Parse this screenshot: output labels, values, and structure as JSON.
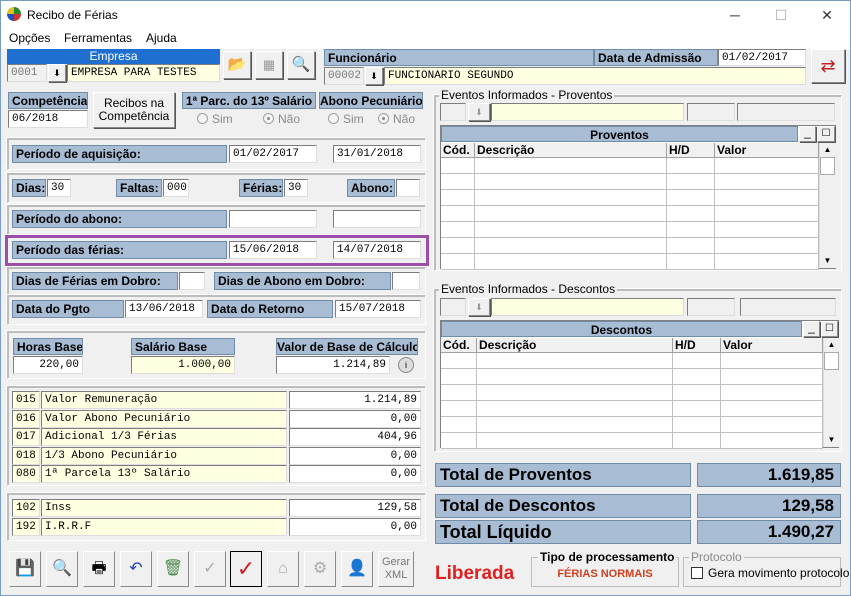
{
  "window": {
    "title": "Recibo de Férias",
    "min": "─",
    "max": "☐",
    "close": "✕"
  },
  "menu": [
    "Opções",
    "Ferramentas",
    "Ajuda"
  ],
  "empresa": {
    "label": "Empresa",
    "code": "0001",
    "name": "EMPRESA PARA TESTES"
  },
  "funcionario": {
    "label": "Funcionário",
    "code": "00002",
    "name": "FUNCIONARIO SEGUNDO",
    "adm_label": "Data de Admissão",
    "adm": "01/02/2017"
  },
  "competencia": {
    "label": "Competência",
    "value": "06/2018",
    "recibos_btn": "Recibos na Competência"
  },
  "parc13": {
    "label": "1ª Parc. do 13º Salário",
    "sim": "Sim",
    "nao": "Não"
  },
  "abono": {
    "label": "Abono Pecuniário",
    "sim": "Sim",
    "nao": "Não"
  },
  "aquisicao": {
    "label": "Período de aquisição:",
    "start": "01/02/2017",
    "end": "31/01/2018"
  },
  "dias": {
    "dias_label": "Dias:",
    "dias": "30",
    "faltas_label": "Faltas:",
    "faltas": "000",
    "ferias_label": "Férias:",
    "ferias": "30",
    "abono_label": "Abono:",
    "abono": ""
  },
  "periodo_abono": {
    "label": "Período do abono:"
  },
  "periodo_ferias": {
    "label": "Período das férias:",
    "start": "15/06/2018",
    "end": "14/07/2018"
  },
  "dobro": {
    "ferias_label": "Dias de Férias em Dobro:",
    "abono_label": "Dias de Abono em Dobro:"
  },
  "pgto": {
    "label": "Data do Pgto",
    "value": "13/06/2018",
    "ret_label": "Data do Retorno",
    "ret": "15/07/2018"
  },
  "base": {
    "horas_label": "Horas Base",
    "horas": "220,00",
    "salario_label": "Salário Base",
    "salario": "1.000,00",
    "valor_label": "Valor de Base de Cálculo",
    "valor": "1.214,89"
  },
  "proventos_rows": [
    {
      "code": "015",
      "desc": "Valor Remuneração",
      "value": "1.214,89"
    },
    {
      "code": "016",
      "desc": "Valor Abono Pecuniário",
      "value": "0,00"
    },
    {
      "code": "017",
      "desc": "Adicional 1/3 Férias",
      "value": "404,96"
    },
    {
      "code": "018",
      "desc": "1/3 Abono Pecuniário",
      "value": "0,00"
    },
    {
      "code": "080",
      "desc": "1ª Parcela 13º Salário",
      "value": "0,00"
    }
  ],
  "descontos_rows": [
    {
      "code": "102",
      "desc": "Inss",
      "value": "129,58"
    },
    {
      "code": "192",
      "desc": "I.R.R.F",
      "value": "0,00"
    }
  ],
  "ev_prov": {
    "group": "Eventos Informados - Proventos",
    "title": "Proventos",
    "cols": [
      "Cód.",
      "Descrição",
      "H/D",
      "Valor"
    ]
  },
  "ev_desc": {
    "group": "Eventos Informados - Descontos",
    "title": "Descontos",
    "cols": [
      "Cód.",
      "Descrição",
      "H/D",
      "Valor"
    ]
  },
  "totais": {
    "prov_label": "Total de Proventos",
    "prov": "1.619,85",
    "desc_label": "Total de Descontos",
    "desc": "129,58",
    "liq_label": "Total Líquido",
    "liq": "1.490,27"
  },
  "status": "Liberada",
  "tipo": {
    "label": "Tipo de processamento",
    "value": "FÉRIAS NORMAIS"
  },
  "protocolo": {
    "label": "Protocolo",
    "check": "Gera movimento protocolo"
  },
  "toolbar": {
    "xml": "Gerar XML"
  },
  "colors": {
    "label_bg": "#a8bcd4",
    "highlight": "#9b4fa8",
    "status": "#e02020"
  }
}
